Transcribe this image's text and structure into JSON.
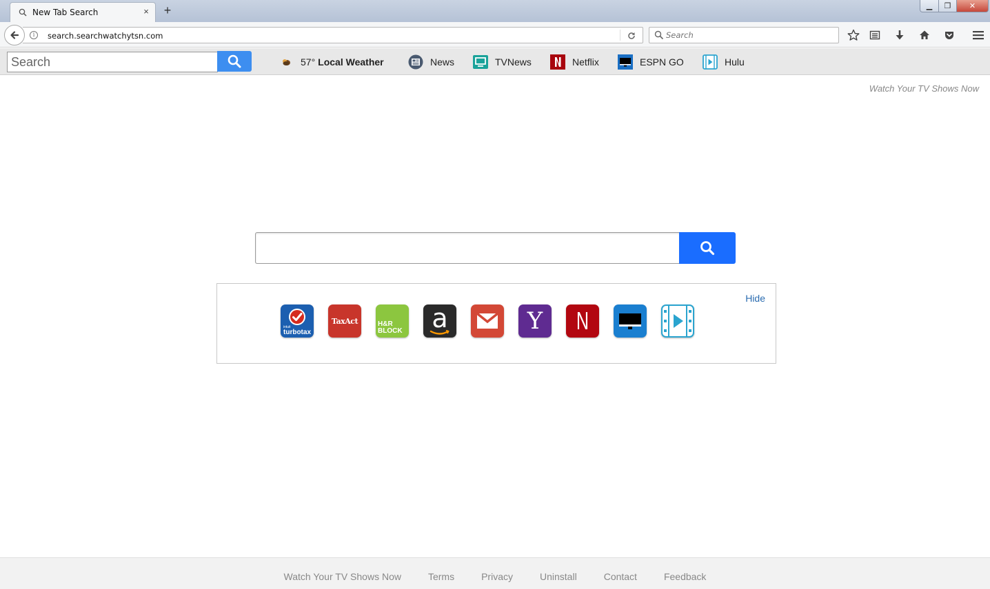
{
  "browser": {
    "tab_title": "New Tab Search",
    "tab_close": "×",
    "new_tab": "+",
    "url": "search.searchwatchytsn.com",
    "search_placeholder": "Search",
    "window_min": "▁",
    "window_max": "❐",
    "window_close": "✕"
  },
  "toolbar": {
    "search_placeholder": "Search",
    "weather_temp": "57°",
    "weather_label": "Local Weather",
    "links": [
      {
        "label": "News"
      },
      {
        "label": "TVNews"
      },
      {
        "label": "Netflix"
      },
      {
        "label": "ESPN GO"
      },
      {
        "label": "Hulu"
      }
    ]
  },
  "main": {
    "brand": "Watch Your TV Shows Now",
    "hide_label": "Hide",
    "tiles": [
      {
        "name": "turbotax",
        "line1": "intuit",
        "line2": "turbotax",
        "color": "#1c5fb0"
      },
      {
        "name": "taxact",
        "text": "TaxAct",
        "color": "#c8352b"
      },
      {
        "name": "hrblock",
        "line1": "H&R",
        "line2": "BLOCK",
        "color": "#8cc63f"
      },
      {
        "name": "amazon",
        "text": "a",
        "color": "#2a2a2a"
      },
      {
        "name": "gmail",
        "color": "#d34836"
      },
      {
        "name": "yahoo",
        "text": "Y",
        "color": "#5f2b91"
      },
      {
        "name": "netflix",
        "text": "N",
        "color": "#b20710"
      },
      {
        "name": "espn",
        "color": "#1a7fd0"
      },
      {
        "name": "hulu",
        "color": "#ffffff"
      }
    ]
  },
  "footer": {
    "links": [
      "Watch Your TV Shows Now",
      "Terms",
      "Privacy",
      "Uninstall",
      "Contact",
      "Feedback"
    ]
  }
}
